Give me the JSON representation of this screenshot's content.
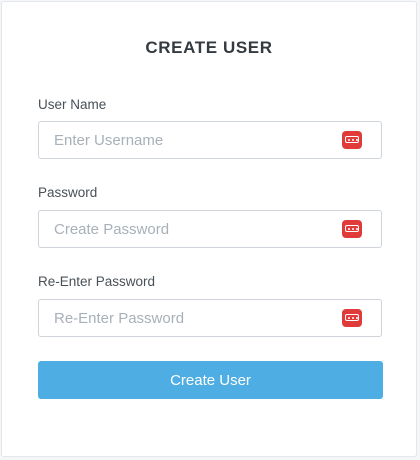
{
  "form": {
    "title": "CREATE USER",
    "fields": [
      {
        "label": "User Name",
        "placeholder": "Enter Username",
        "value": "",
        "icon": "password-manager-icon"
      },
      {
        "label": "Password",
        "placeholder": "Create Password",
        "value": "",
        "icon": "password-manager-icon"
      },
      {
        "label": "Re-Enter Password",
        "placeholder": "Re-Enter Password",
        "value": "",
        "icon": "password-manager-icon"
      }
    ],
    "submit_label": "Create User"
  },
  "colors": {
    "accent": "#4eaee3",
    "icon_badge": "#e03a3a",
    "input_border": "#ced4da",
    "title_text": "#333a40"
  }
}
